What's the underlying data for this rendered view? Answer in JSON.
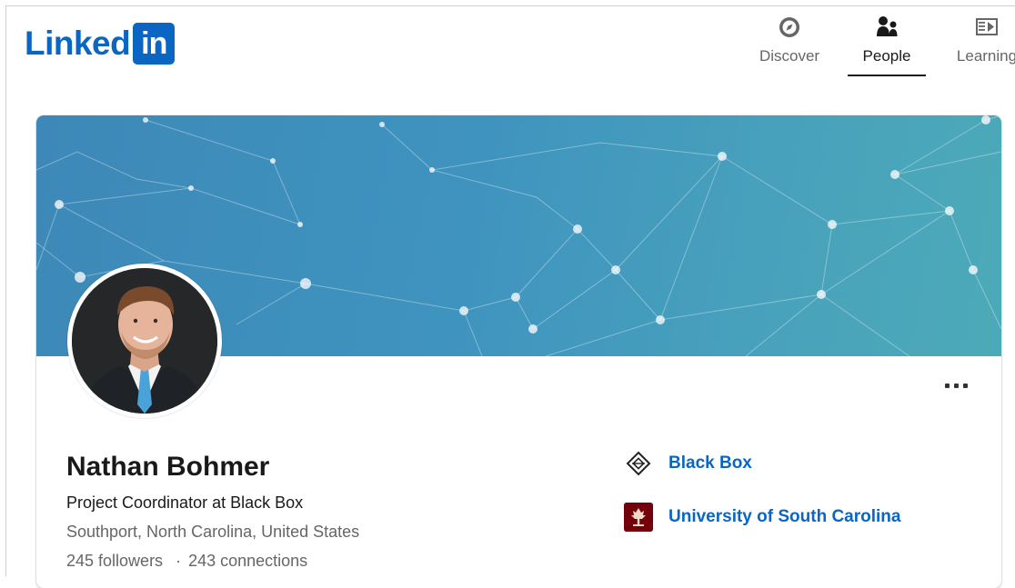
{
  "brand": {
    "logo_text": "Linked",
    "logo_box": "in",
    "color": "#0a66c2"
  },
  "nav": {
    "items": [
      {
        "label": "Discover",
        "icon": "compass-icon",
        "active": false
      },
      {
        "label": "People",
        "icon": "people-icon",
        "active": true
      },
      {
        "label": "Learning",
        "icon": "learning-icon",
        "active": false
      }
    ]
  },
  "profile": {
    "name": "Nathan Bohmer",
    "headline": "Project Coordinator at Black Box",
    "location": "Southport, North Carolina, United States",
    "followers": "245 followers",
    "separator": "·",
    "connections": "243 connections",
    "banner_colors": [
      "#3d88b8",
      "#4caab8"
    ]
  },
  "affiliations": {
    "company": {
      "label": "Black Box",
      "icon": "black-box-logo-icon"
    },
    "school": {
      "label": "University of South Carolina",
      "icon": "usc-logo-icon",
      "color": "#73000a"
    }
  },
  "more_icon": "ellipsis-icon"
}
